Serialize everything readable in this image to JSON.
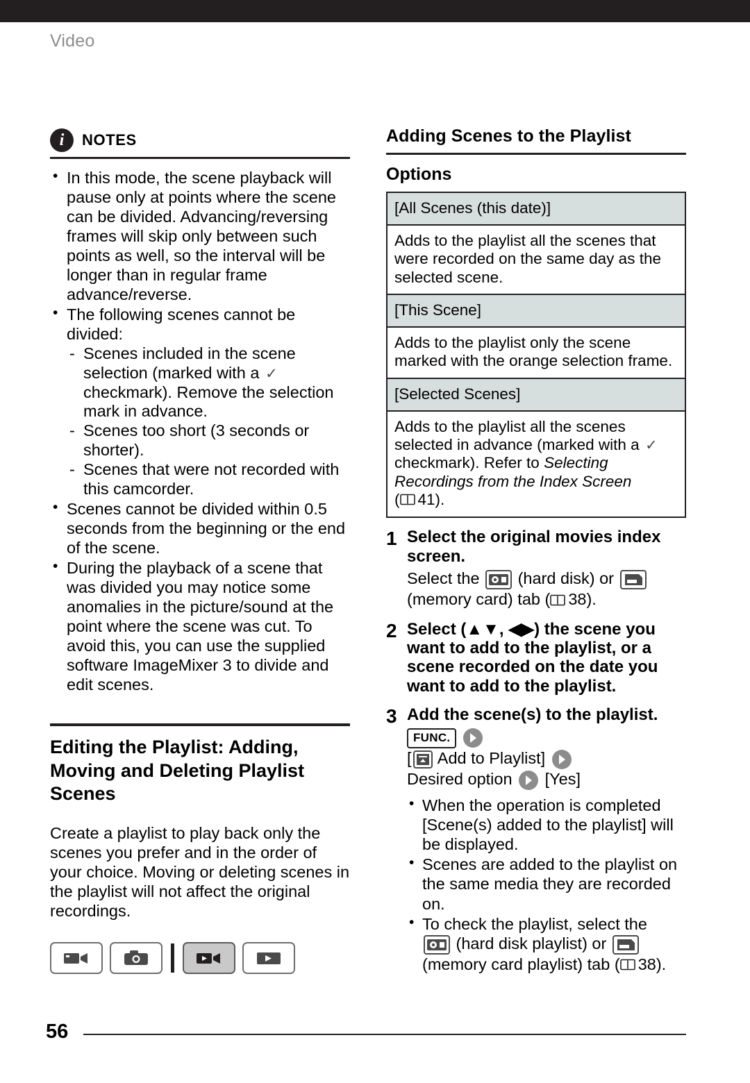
{
  "header": {
    "section": "Video"
  },
  "notes": {
    "title": "NOTES",
    "icon": "info-icon",
    "items": [
      {
        "text": "In this mode, the scene playback will pause only at points where the scene can be divided. Advancing/reversing frames will skip only between such points as well, so the interval will be longer than in regular frame advance/reverse."
      },
      {
        "text": "The following scenes cannot be divided:",
        "sub": [
          "Scenes included in the scene selection (marked with a ✓ checkmark). Remove the selection mark in advance.",
          "Scenes too short (3 seconds or shorter).",
          "Scenes that were not recorded with this camcorder."
        ]
      },
      {
        "text": "Scenes cannot be divided within 0.5 seconds from the beginning or the end of the scene."
      },
      {
        "text": "During the playback of a scene that was divided you may notice some anomalies in the picture/sound at the point where the scene was cut. To avoid this, you can use the supplied software ImageMixer 3 to divide and edit scenes."
      }
    ]
  },
  "left_section": {
    "heading": "Editing the Playlist: Adding, Moving and Deleting Playlist Scenes",
    "paragraph": "Create a playlist to play back only the scenes you prefer and in the order of your choice. Moving or deleting scenes in the playlist will not affect the original recordings.",
    "tabs": [
      {
        "name": "movie-record-tab",
        "icon": "camera-movie-icon",
        "active": false
      },
      {
        "name": "photo-record-tab",
        "icon": "still-camera-icon",
        "active": false
      },
      {
        "name": "movie-playback-tab",
        "icon": "movie-playback-icon",
        "active": true
      },
      {
        "name": "photo-playback-tab",
        "icon": "photo-playback-icon",
        "active": false
      }
    ]
  },
  "right_section": {
    "heading": "Adding Scenes to the Playlist",
    "options_label": "Options",
    "options": [
      {
        "name": "[All Scenes (this date)]",
        "desc": "Adds to the playlist all the scenes that were recorded on the same day as the selected scene."
      },
      {
        "name": "[This Scene]",
        "desc": "Adds to the playlist only the scene marked with the orange selection frame."
      },
      {
        "name": "[Selected Scenes]",
        "desc_part1": "Adds to the playlist all the scenes selected in advance (marked with a",
        "desc_part2": "checkmark). Refer to",
        "desc_italic": "Selecting Recordings from the Index Screen",
        "desc_page": "41",
        "desc_paren_open": "(",
        "desc_paren_close": ").",
        "checkmark": "✓"
      }
    ],
    "steps": [
      {
        "num": "1",
        "title": "Select the original movies index screen.",
        "detail_pre": "Select the",
        "detail_mid": "(hard disk) or",
        "detail_post": "(memory card) tab (",
        "detail_page": "38",
        "detail_end": ")."
      },
      {
        "num": "2",
        "title_pre": "Select (",
        "title_post": ") the scene you want to add to the playlist, or a scene recorded on the date you want to add to the playlist.",
        "pad_symbols": "▲▼, ◀▶"
      },
      {
        "num": "3",
        "title": "Add the scene(s) to the playlist.",
        "func_label": "FUNC.",
        "add_to_playlist": "[    Add to Playlist]",
        "add_to_playlist_text": "Add to Playlist]",
        "desired_option": "Desired option",
        "yes_option": "[Yes]",
        "notes": [
          "When the operation is completed [Scene(s) added to the playlist] will be displayed.",
          "Scenes are added to the playlist on the same media they are recorded on.",
          "To check the playlist, select the"
        ],
        "last_note_pre": "To check the playlist, select the",
        "last_note_mid": "(hard disk playlist) or",
        "last_note_post": "(memory card playlist) tab (",
        "last_note_page": "38",
        "last_note_end": ")."
      }
    ]
  },
  "footer": {
    "page_number": "56"
  }
}
